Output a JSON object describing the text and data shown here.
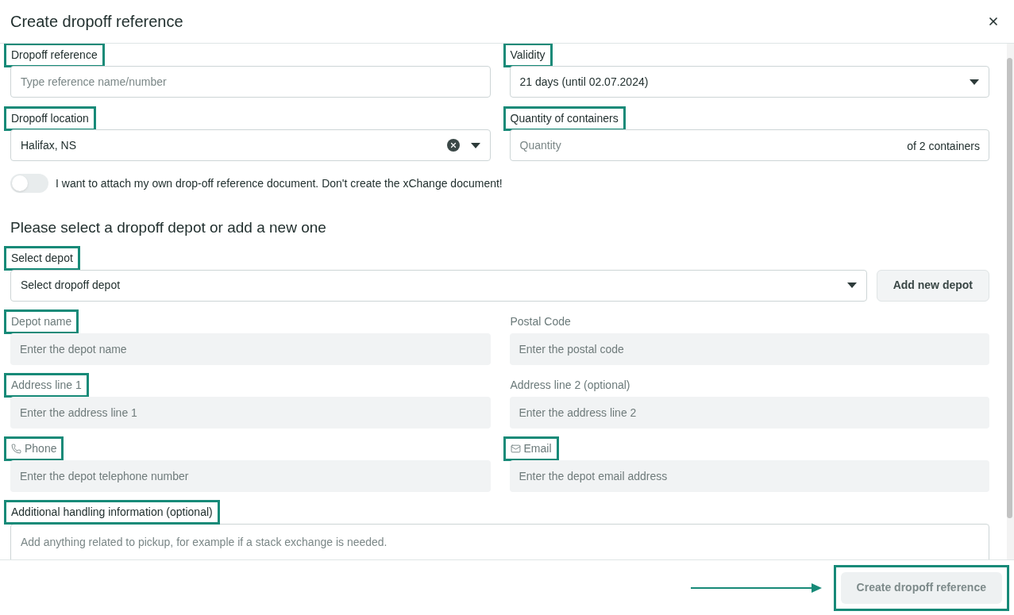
{
  "dialog": {
    "title": "Create dropoff reference"
  },
  "top_fields": [
    {
      "kind": "input",
      "label": "Dropoff reference",
      "highlighted": true,
      "placeholder": "Type reference name/number"
    },
    {
      "kind": "select",
      "label": "Validity",
      "highlighted": true,
      "value": "21 days (until 02.07.2024)"
    },
    {
      "kind": "clearable-select",
      "label": "Dropoff location",
      "highlighted": true,
      "value": "Halifax, NS"
    },
    {
      "kind": "quantity",
      "label": "Quantity of containers",
      "highlighted": true,
      "placeholder": "Quantity",
      "suffix": "of 2 containers"
    }
  ],
  "attach_toggle": {
    "on": false,
    "label": "I want to attach my own drop-off reference document. Don't create the xChange document!"
  },
  "depot_section": {
    "heading": "Please select a dropoff depot or add a new one",
    "select": {
      "label": "Select depot",
      "highlighted": true,
      "placeholder": "Select dropoff depot"
    },
    "add_button": "Add new depot",
    "fields": [
      {
        "label": "Depot name",
        "kind": "plain",
        "highlighted": true,
        "disabled": true,
        "placeholder": "Enter the depot name"
      },
      {
        "label": "Postal Code",
        "kind": "plain",
        "highlighted": false,
        "disabled": true,
        "placeholder": "Enter the postal code"
      },
      {
        "label": "Address line 1",
        "kind": "plain",
        "highlighted": true,
        "disabled": true,
        "placeholder": "Enter the address line 1"
      },
      {
        "label": "Address line 2 (optional)",
        "kind": "plain",
        "highlighted": false,
        "disabled": true,
        "placeholder": "Enter the address line 2"
      },
      {
        "label": "Phone",
        "kind": "phone",
        "highlighted": true,
        "disabled": true,
        "placeholder": "Enter the depot telephone number"
      },
      {
        "label": "Email",
        "kind": "email",
        "highlighted": true,
        "disabled": true,
        "placeholder": "Enter the depot email address"
      }
    ]
  },
  "handling": {
    "label": "Additional handling information (optional)",
    "highlighted": true,
    "placeholder": "Add anything related to pickup, for example if a stack exchange is needed."
  },
  "footer": {
    "button": {
      "label": "Create dropoff reference",
      "disabled": true,
      "highlighted": true
    }
  }
}
